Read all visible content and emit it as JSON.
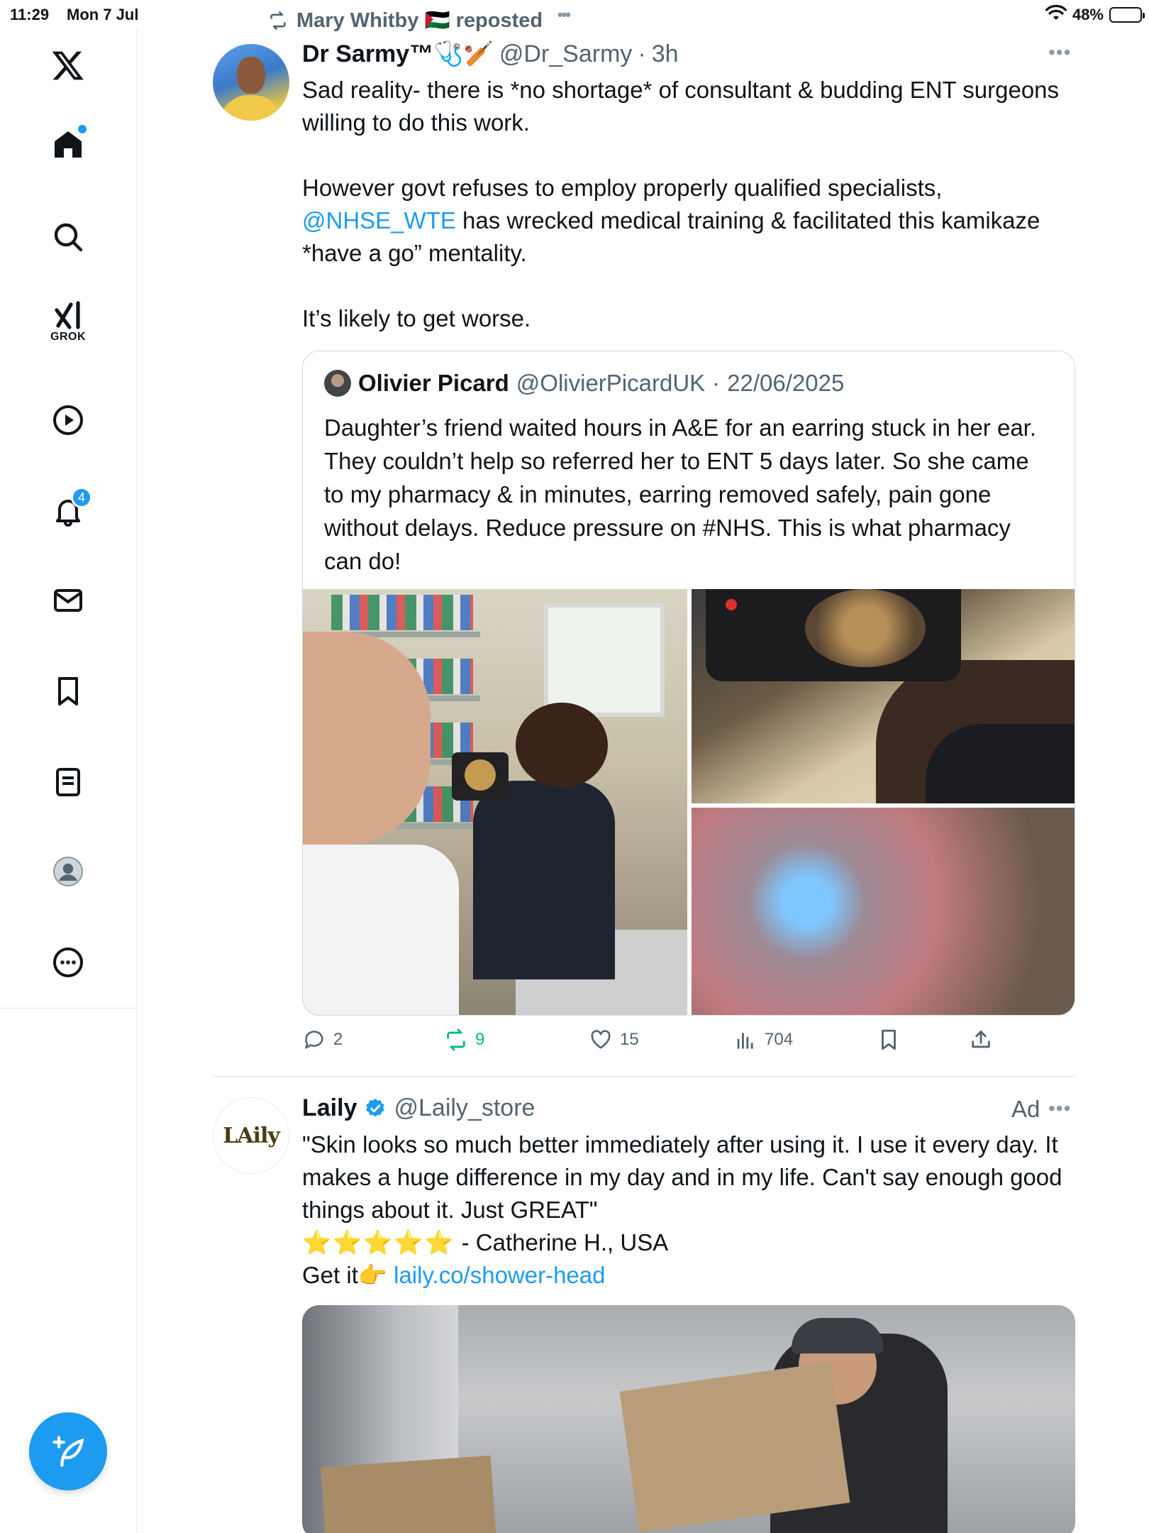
{
  "status_bar": {
    "time": "11:29",
    "date": "Mon 7 Jul",
    "battery": "48%",
    "battery_level": 0.48
  },
  "sidebar": {
    "items": [
      {
        "icon": "x-logo-icon"
      },
      {
        "icon": "home-icon",
        "has_dot": true
      },
      {
        "icon": "search-icon"
      },
      {
        "icon": "grok-icon",
        "label": "GROK"
      },
      {
        "icon": "video-play-icon"
      },
      {
        "icon": "notifications-bell-icon",
        "badge": "4"
      },
      {
        "icon": "messages-envelope-icon"
      },
      {
        "icon": "bookmarks-icon"
      },
      {
        "icon": "lists-icon"
      },
      {
        "icon": "profile-avatar-icon"
      },
      {
        "icon": "more-options-icon"
      }
    ],
    "compose_icon": "compose-feather-icon"
  },
  "tweet1": {
    "repost_by": "Mary Whitby 🇵🇸 reposted",
    "author": {
      "name": "Dr Sarmy™🩺🏏",
      "handle": "@Dr_Sarmy",
      "separator": "·",
      "time": "3h"
    },
    "text_lines": [
      "Sad reality- there is *no shortage* of consultant & budding ENT surgeons willing to do this work.",
      "",
      "However govt refuses to employ properly qualified specialists, ",
      "",
      "It’s likely to get worse."
    ],
    "mention": "@NHSE_WTE",
    "mention_suffix": " has wrecked medical training & facilitated this kamikaze *have a go” mentality.",
    "quote": {
      "name": "Olivier Picard",
      "handle": "@OlivierPicardUK",
      "separator": "·",
      "date": "22/06/2025",
      "text": "Daughter’s friend waited hours in A&E for an earring stuck in her ear. They couldn’t help so referred her to ENT 5 days later. So she came to my pharmacy & in minutes, earring removed safely, pain gone without delays. Reduce pressure on #NHS. This is what pharmacy can do!"
    },
    "actions": {
      "replies": "2",
      "reposts": "9",
      "likes": "15",
      "views": "704"
    }
  },
  "ad": {
    "name": "Laily",
    "handle": "@Laily_store",
    "label": "Ad",
    "logo_text": "LAily",
    "text_quote": "\"Skin looks so much better immediately after using it. I use it every day. It makes a huge difference in my day and in my life. Can't say enough good things about it. Just GREAT\"",
    "stars": "⭐⭐⭐⭐⭐",
    "attribution": " - Catherine H., USA",
    "cta": "Get it👉 ",
    "link": "laily.co/shower-head"
  },
  "colors": {
    "accent": "#1d9bf0",
    "repost_green": "#00ba7c",
    "secondary_text": "#536471"
  }
}
